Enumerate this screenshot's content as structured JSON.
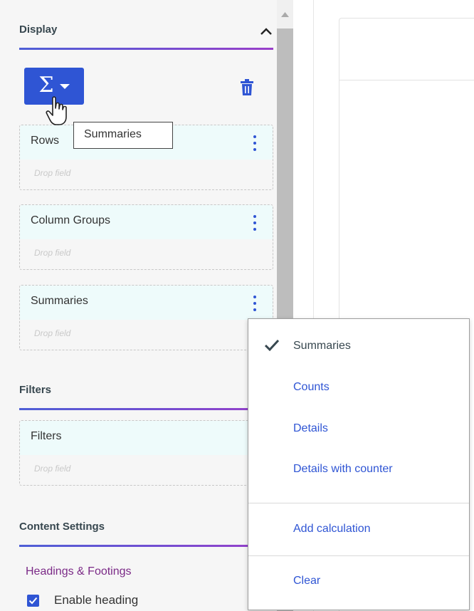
{
  "display": {
    "title": "Display",
    "sum_button_glyph": "Σ",
    "tooltip": "Summaries"
  },
  "zones": [
    {
      "label": "Rows",
      "placeholder": "Drop field"
    },
    {
      "label": "Column Groups",
      "placeholder": "Drop field"
    },
    {
      "label": "Summaries",
      "placeholder": "Drop field"
    }
  ],
  "filters": {
    "title": "Filters",
    "zone": {
      "label": "Filters",
      "placeholder": "Drop field"
    }
  },
  "content_settings": {
    "title": "Content Settings",
    "subheading": "Headings & Footings",
    "enable_heading_label": "Enable heading",
    "enable_heading_checked": true
  },
  "menu": {
    "items": [
      {
        "label": "Summaries",
        "selected": true
      },
      {
        "label": "Counts",
        "selected": false
      },
      {
        "label": "Details",
        "selected": false
      },
      {
        "label": "Details with counter",
        "selected": false
      },
      {
        "label": "Add calculation",
        "selected": false
      },
      {
        "label": "Clear",
        "selected": false
      }
    ]
  },
  "colors": {
    "accent": "#2f55d4",
    "heading_purple": "#7b2a87",
    "zone_header_bg": "#eefbfb"
  },
  "icons": [
    "chevron-up-icon",
    "sigma-icon",
    "caret-down-icon",
    "hand-cursor-icon",
    "trash-icon",
    "kebab-menu-icon",
    "check-icon",
    "scroll-up-arrow-icon"
  ]
}
